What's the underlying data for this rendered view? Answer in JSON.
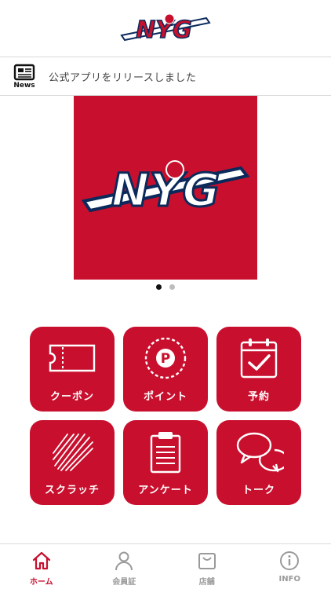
{
  "brand": {
    "logo_text": "NYG",
    "primary_color": "#c8102e",
    "navy_color": "#0b2a5b"
  },
  "news": {
    "icon_label": "News",
    "headline": "公式アプリをリリースしました"
  },
  "carousel": {
    "slide_count": 2,
    "active_index": 0
  },
  "menu": [
    {
      "label": "クーポン",
      "icon": "ticket-icon"
    },
    {
      "label": "ポイント",
      "icon": "point-icon"
    },
    {
      "label": "予約",
      "icon": "calendar-check-icon"
    },
    {
      "label": "スクラッチ",
      "icon": "scratch-icon"
    },
    {
      "label": "アンケート",
      "icon": "clipboard-icon"
    },
    {
      "label": "トーク",
      "icon": "chat-bubbles-icon"
    }
  ],
  "tabbar": [
    {
      "label": "ホーム",
      "icon": "home-icon",
      "active": true
    },
    {
      "label": "会員証",
      "icon": "person-icon",
      "active": false
    },
    {
      "label": "店舗",
      "icon": "shop-icon",
      "active": false
    },
    {
      "label": "INFO",
      "icon": "info-icon",
      "active": false
    }
  ]
}
